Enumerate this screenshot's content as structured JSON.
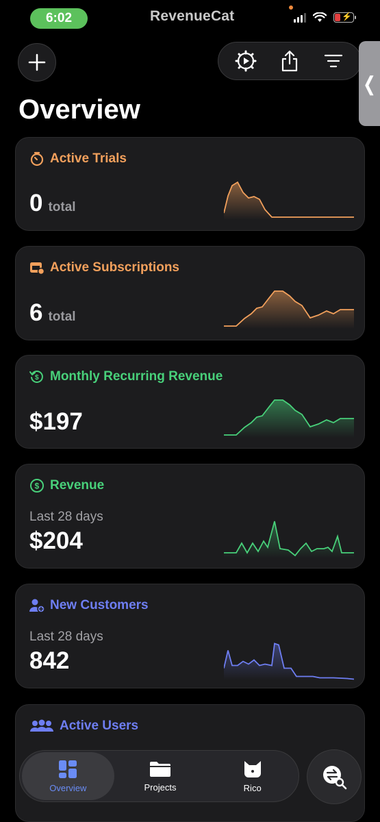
{
  "status_bar": {
    "time": "6:02",
    "brand": "RevenueCat"
  },
  "page": {
    "title": "Overview"
  },
  "colors": {
    "orange": "#f2a05c",
    "green": "#48d07a",
    "blue": "#6e7ef2",
    "card": "#1c1c1e"
  },
  "cards": [
    {
      "title": "Active Trials",
      "value": "0",
      "unit": "total",
      "icon": "stopwatch-icon"
    },
    {
      "title": "Active Subscriptions",
      "value": "6",
      "unit": "total",
      "icon": "calendar-icon"
    },
    {
      "title": "Monthly Recurring Revenue",
      "value": "$197",
      "icon": "recurring-dollar-icon"
    },
    {
      "title": "Revenue",
      "subtitle": "Last 28 days",
      "value": "$204",
      "icon": "dollar-circle-icon"
    },
    {
      "title": "New Customers",
      "subtitle": "Last 28 days",
      "value": "842",
      "icon": "add-person-icon"
    },
    {
      "title": "Active Users",
      "icon": "people-icon"
    }
  ],
  "nav": {
    "overview": "Overview",
    "projects": "Projects",
    "rico": "Rico"
  }
}
